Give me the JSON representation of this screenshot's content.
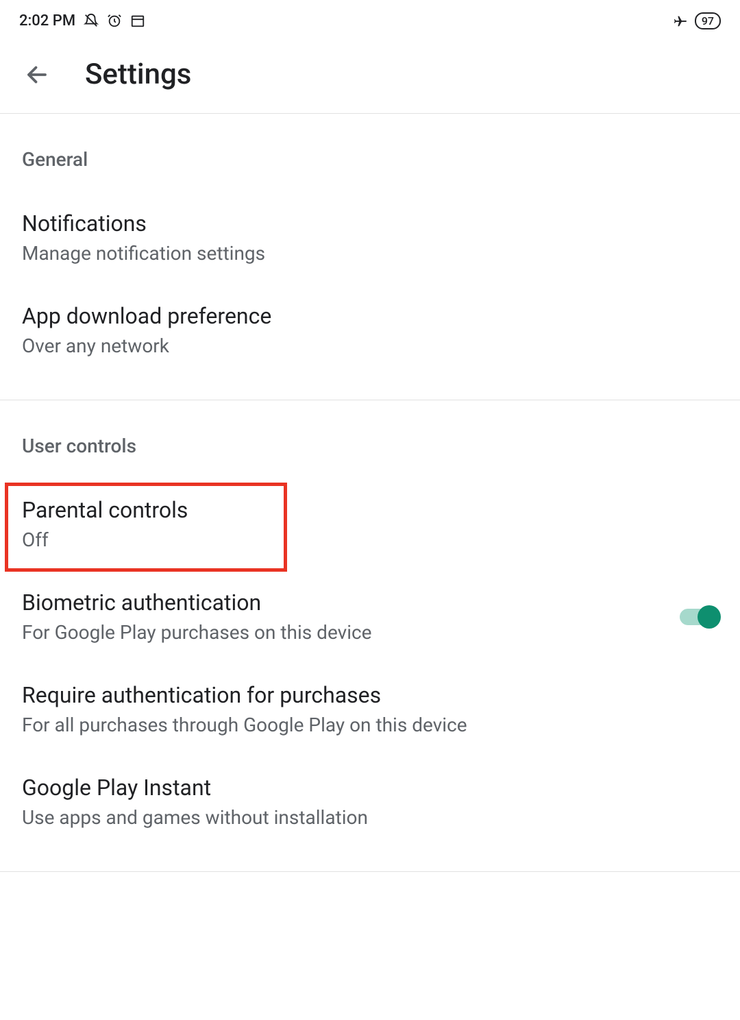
{
  "status_bar": {
    "time": "2:02 PM",
    "battery": "97"
  },
  "toolbar": {
    "title": "Settings"
  },
  "sections": {
    "general": {
      "header": "General",
      "items": [
        {
          "title": "Notifications",
          "subtitle": "Manage notification settings"
        },
        {
          "title": "App download preference",
          "subtitle": "Over any network"
        }
      ]
    },
    "user_controls": {
      "header": "User controls",
      "items": [
        {
          "title": "Parental controls",
          "subtitle": "Off"
        },
        {
          "title": "Biometric authentication",
          "subtitle": "For Google Play purchases on this device",
          "toggle_on": true
        },
        {
          "title": "Require authentication for purchases",
          "subtitle": "For all purchases through Google Play on this device"
        },
        {
          "title": "Google Play Instant",
          "subtitle": "Use apps and games without installation"
        }
      ]
    }
  }
}
